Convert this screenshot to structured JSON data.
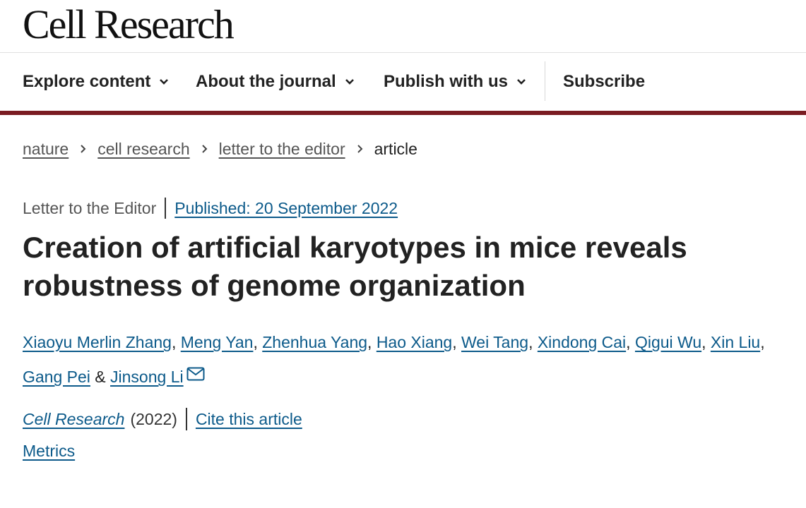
{
  "header": {
    "logo": "Cell Research"
  },
  "nav": {
    "items": [
      {
        "label": "Explore content"
      },
      {
        "label": "About the journal"
      },
      {
        "label": "Publish with us"
      }
    ],
    "subscribe": "Subscribe"
  },
  "breadcrumb": {
    "items": [
      "nature",
      "cell research",
      "letter to the editor"
    ],
    "current": "article"
  },
  "article": {
    "type": "Letter to the Editor",
    "published": "Published: 20 September 2022",
    "title": "Creation of artificial karyotypes in mice reveals robustness of genome organization",
    "authors": [
      "Xiaoyu Merlin Zhang",
      "Meng Yan",
      "Zhenhua Yang",
      "Hao Xiang",
      "Wei Tang",
      "Xindong Cai",
      "Qigui Wu",
      "Xin Liu",
      "Gang Pei",
      "Jinsong Li"
    ],
    "author_separator": ", ",
    "last_separator": " & ",
    "journal": "Cell Research",
    "year": "(2022)",
    "cite": "Cite this article",
    "metrics": "Metrics"
  },
  "colors": {
    "accent_bar": "#7a1c22",
    "link": "#0c5a8a"
  },
  "icons": {
    "nav_chevron": "chevron-down-icon",
    "breadcrumb_separator": "chevron-right-icon",
    "corresponding_author": "mail-icon"
  }
}
